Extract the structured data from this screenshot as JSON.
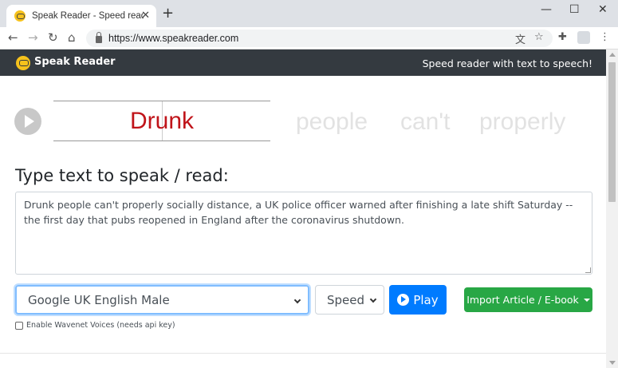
{
  "browser": {
    "tab_title": "Speak Reader - Speed reader with text to speech",
    "tab_close": "✕",
    "new_tab": "+",
    "url": "https://www.speakreader.com",
    "controls": {
      "minimize": "—",
      "maximize": "☐",
      "close": "✕"
    },
    "nav": {
      "back": "←",
      "forward": "→",
      "reload": "↻",
      "home": "⌂"
    },
    "toolbar_icons": {
      "translate": "文",
      "bookmark": "☆",
      "extensions": "✚",
      "menu": "⋮"
    }
  },
  "site": {
    "brand": "Speak Reader",
    "tagline": "Speed reader with text to speech!"
  },
  "reader": {
    "current_word": "Drunk",
    "next_words": [
      "people",
      "can't",
      "properly"
    ]
  },
  "main": {
    "heading": "Type text to speak / read:",
    "text": "Drunk people can't properly socially distance, a UK police officer warned after finishing a late shift Saturday -- the first day that pubs reopened in England after the coronavirus shutdown.",
    "voice_select": "Google UK English Male",
    "speed_select": "Speed",
    "play_label": "Play",
    "import_label": "Import Article / E-book",
    "wavenet_label": "Enable Wavenet Voices (needs api key)"
  },
  "colors": {
    "current_word": "#c0141a",
    "next_words": "#e2e2e2",
    "play_button": "#007bff",
    "import_button": "#28a745",
    "navbar": "#343a40",
    "logo": "#f6c21c"
  }
}
